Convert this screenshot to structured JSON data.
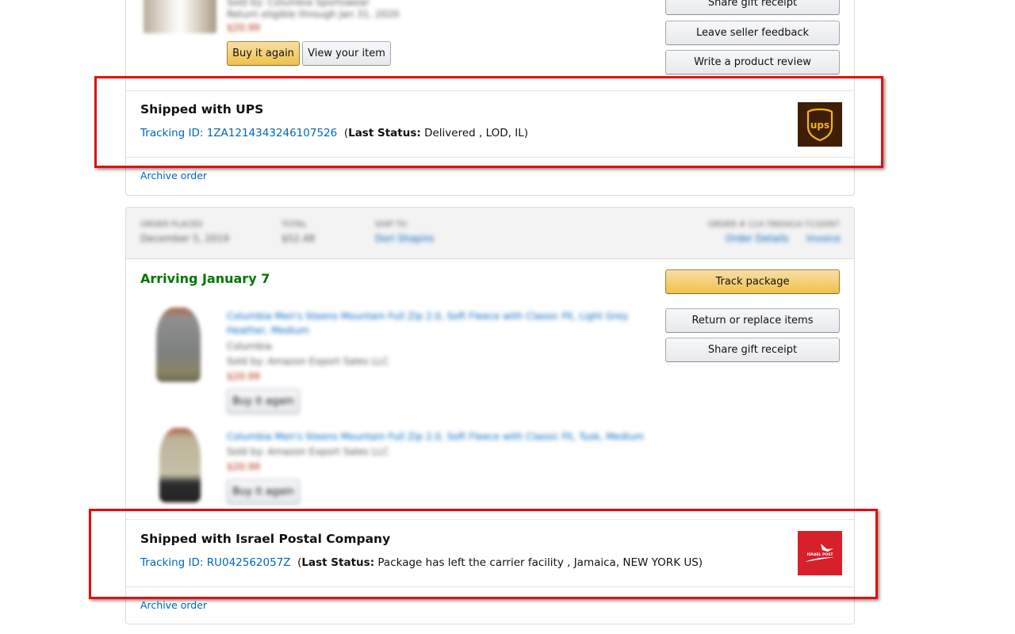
{
  "order1": {
    "blurred_item": {
      "sold_by": "Sold by: Columbia Sportswear",
      "return_eligible": "Return eligible through Jan 31, 2020",
      "price": "$20.99"
    },
    "buttons": {
      "buy_again": "Buy it again",
      "view_item": "View your item",
      "share_gift_receipt": "Share gift receipt",
      "leave_seller_feedback": "Leave seller feedback",
      "write_review": "Write a product review"
    },
    "shipment": {
      "title": "Shipped with UPS",
      "tracking_prefix": "Tracking ID: ",
      "tracking_id": "1ZA1214343246107526",
      "status_open": "(",
      "status_label": "Last Status:",
      "status_text": " Delivered ,   LOD, IL)",
      "carrier_logo": "ups-logo",
      "carrier_logo_text": "ups"
    },
    "archive_label": "Archive order"
  },
  "order2": {
    "header": {
      "placed_label": "ORDER PLACED",
      "placed_value": "December 5, 2019",
      "total_label": "TOTAL",
      "total_value": "$52.48",
      "ship_to_label": "SHIP TO",
      "ship_to_value": "Dori Shapiro",
      "order_number": "ORDER # 114-7893414-7132097",
      "order_details_link": "Order Details",
      "invoice_link": "Invoice"
    },
    "arriving": "Arriving January 7",
    "buttons": {
      "track_package": "Track package",
      "return_replace": "Return or replace items",
      "share_gift_receipt": "Share gift receipt"
    },
    "items": [
      {
        "title_line1": "Columbia Men's Steens Mountain Full Zip 2.0, Soft Fleece with Classic Fit, Light Grey",
        "title_line2": "Heather, Medium",
        "brand": "Columbia",
        "sold_by": "Sold by: Amazon Export Sales LLC",
        "price": "$20.99",
        "buy_again": "Buy it again"
      },
      {
        "title_line1": "Columbia Men's Steens Mountain Full Zip 2.0, Soft Fleece with Classic Fit, Tusk, Medium",
        "sold_by": "Sold by: Amazon Export Sales LLC",
        "price": "$20.99",
        "buy_again": "Buy it again"
      }
    ],
    "shipment": {
      "title": "Shipped with Israel Postal Company",
      "tracking_prefix": "Tracking ID: ",
      "tracking_id": "RU042562057Z",
      "status_open": "(",
      "status_label": "Last Status:",
      "status_text": " Package has left the carrier facility ,   Jamaica, NEW YORK US)",
      "carrier_logo": "israel-post-logo",
      "carrier_logo_text": "ISRAEL POST"
    },
    "archive_label": "Archive order"
  },
  "colors": {
    "highlight": "#e40d0d",
    "link": "#0066c0",
    "arriving": "#007600",
    "ups_brown": "#3e1f06",
    "ups_gold": "#f5b31b",
    "israel_post_red": "#d8202a"
  }
}
